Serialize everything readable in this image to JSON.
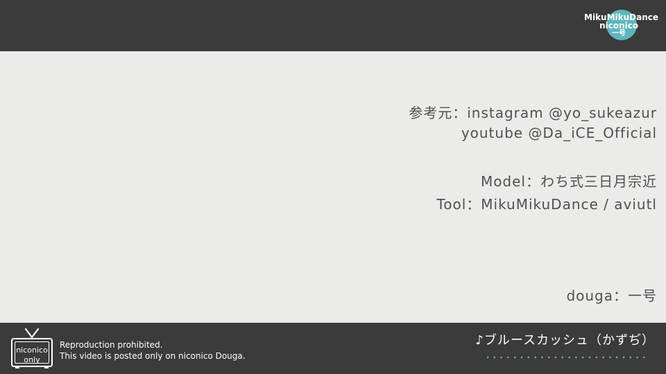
{
  "logo": {
    "line1": "MikuMikuDance",
    "line2": "niconico",
    "line3": "一号",
    "circle_color": "#5fb6be"
  },
  "credits": {
    "reference": "参考元：instagram @yo_sukeazur",
    "reference2": "youtube @Da_iCE_Official",
    "model": "Model：わち式三日月宗近",
    "tool": "Tool：MikuMikuDance / aviutl",
    "douga": "douga：一号"
  },
  "footer": {
    "badge_line1": "niconico",
    "badge_line2": "only",
    "notice_line1": "Reproduction prohibited.",
    "notice_line2": "This video is posted only on niconico Douga.",
    "song": "♪ブルースカッシュ（かずぢ）",
    "dots_color": "#5fb6be"
  },
  "colors": {
    "bar": "#3b3b3b",
    "background": "#ebebea",
    "text": "#505050"
  }
}
